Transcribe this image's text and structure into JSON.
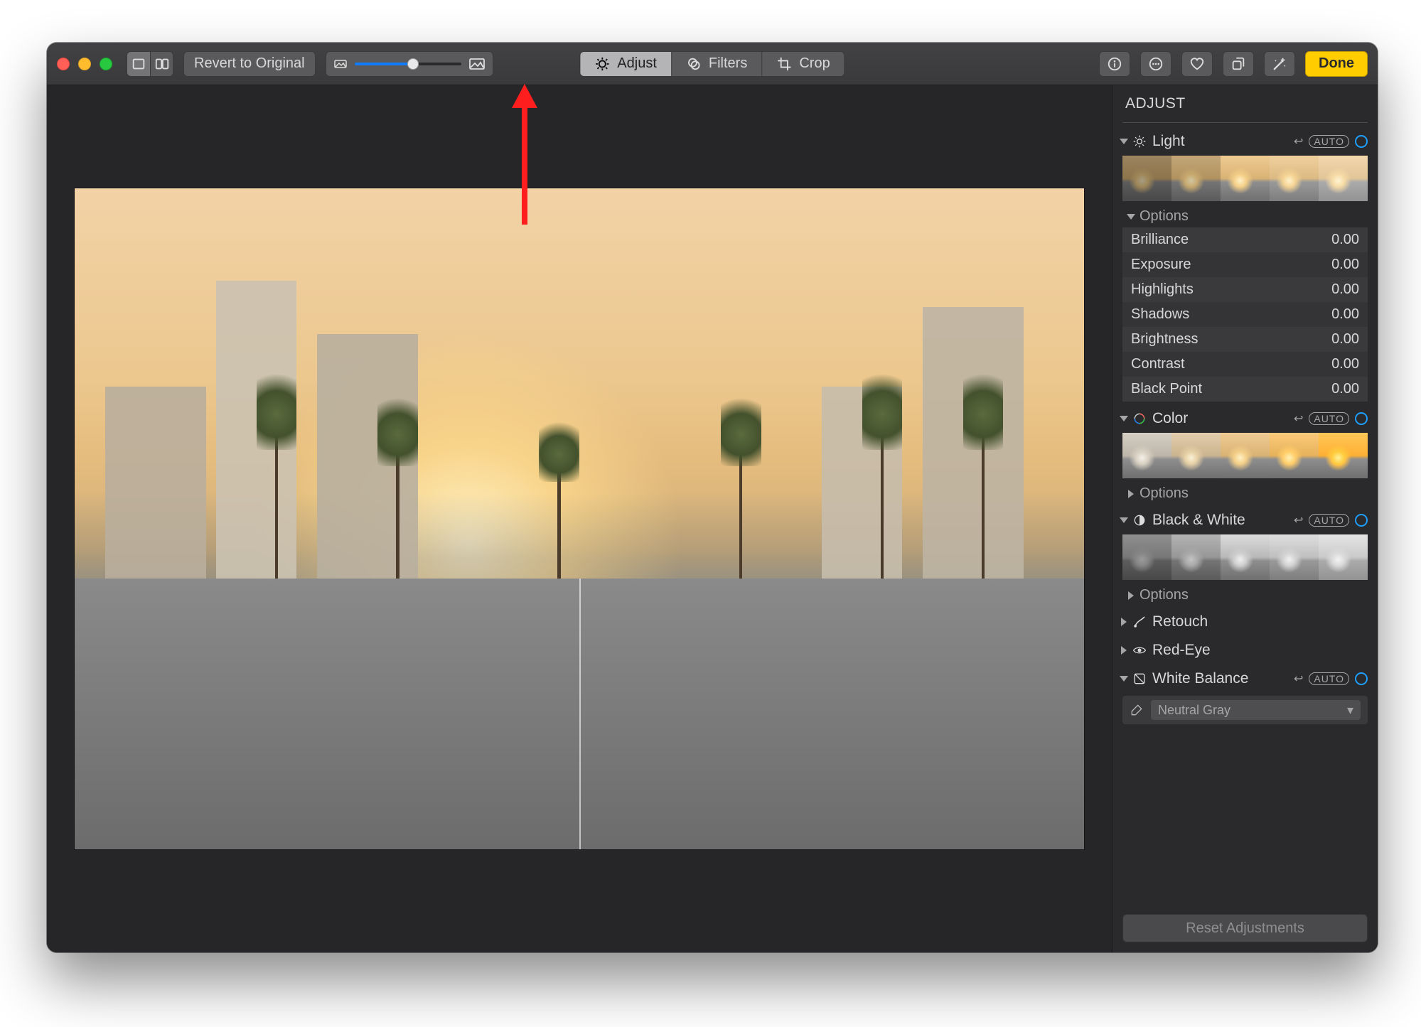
{
  "toolbar": {
    "revert_label": "Revert to Original",
    "zoom_value": 0.55,
    "modes": {
      "adjust": "Adjust",
      "filters": "Filters",
      "crop": "Crop"
    },
    "done_label": "Done"
  },
  "panel": {
    "header": "ADJUST",
    "auto_label": "AUTO",
    "sections": {
      "light": {
        "title": "Light",
        "options_label": "Options",
        "rows": {
          "brilliance": {
            "label": "Brilliance",
            "value": "0.00"
          },
          "exposure": {
            "label": "Exposure",
            "value": "0.00"
          },
          "highlights": {
            "label": "Highlights",
            "value": "0.00"
          },
          "shadows": {
            "label": "Shadows",
            "value": "0.00"
          },
          "brightness": {
            "label": "Brightness",
            "value": "0.00"
          },
          "contrast": {
            "label": "Contrast",
            "value": "0.00"
          },
          "black_point": {
            "label": "Black Point",
            "value": "0.00"
          }
        }
      },
      "color": {
        "title": "Color",
        "options_label": "Options"
      },
      "bw": {
        "title": "Black & White",
        "options_label": "Options"
      },
      "retouch": {
        "title": "Retouch"
      },
      "redeye": {
        "title": "Red-Eye"
      },
      "white_balance": {
        "title": "White Balance",
        "popup_value": "Neutral Gray"
      }
    },
    "reset_label": "Reset Adjustments"
  }
}
